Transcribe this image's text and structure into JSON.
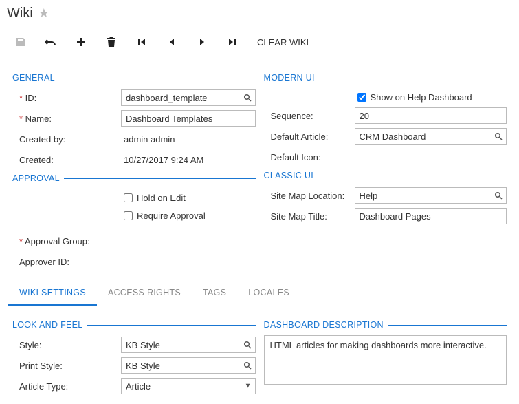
{
  "header": {
    "title": "Wiki"
  },
  "toolbar": {
    "clear": "CLEAR WIKI"
  },
  "general": {
    "heading": "GENERAL",
    "id_label": "ID:",
    "id_value": "dashboard_template",
    "name_label": "Name:",
    "name_value": "Dashboard Templates",
    "created_by_label": "Created by:",
    "created_by_value": "admin admin",
    "created_label": "Created:",
    "created_value": "10/27/2017 9:24 AM"
  },
  "approval": {
    "heading": "APPROVAL",
    "hold_label": "Hold on Edit",
    "require_label": "Require Approval",
    "group_label": "Approval Group:",
    "approver_label": "Approver ID:"
  },
  "modern": {
    "heading": "MODERN UI",
    "show_label": "Show on Help Dashboard",
    "sequence_label": "Sequence:",
    "sequence_value": "20",
    "default_article_label": "Default Article:",
    "default_article_value": "CRM Dashboard",
    "default_icon_label": "Default Icon:"
  },
  "classic": {
    "heading": "CLASSIC UI",
    "sitemap_loc_label": "Site Map Location:",
    "sitemap_loc_value": "Help",
    "sitemap_title_label": "Site Map Title:",
    "sitemap_title_value": "Dashboard Pages"
  },
  "tabs": {
    "wiki_settings": "WIKI SETTINGS",
    "access_rights": "ACCESS RIGHTS",
    "tags": "TAGS",
    "locales": "LOCALES"
  },
  "look_feel": {
    "heading": "LOOK AND FEEL",
    "style_label": "Style:",
    "style_value": "KB Style",
    "print_style_label": "Print Style:",
    "print_style_value": "KB Style",
    "article_type_label": "Article Type:",
    "article_type_value": "Article"
  },
  "dashboard_desc": {
    "heading": "DASHBOARD DESCRIPTION",
    "value": "HTML articles for making dashboards more interactive."
  }
}
